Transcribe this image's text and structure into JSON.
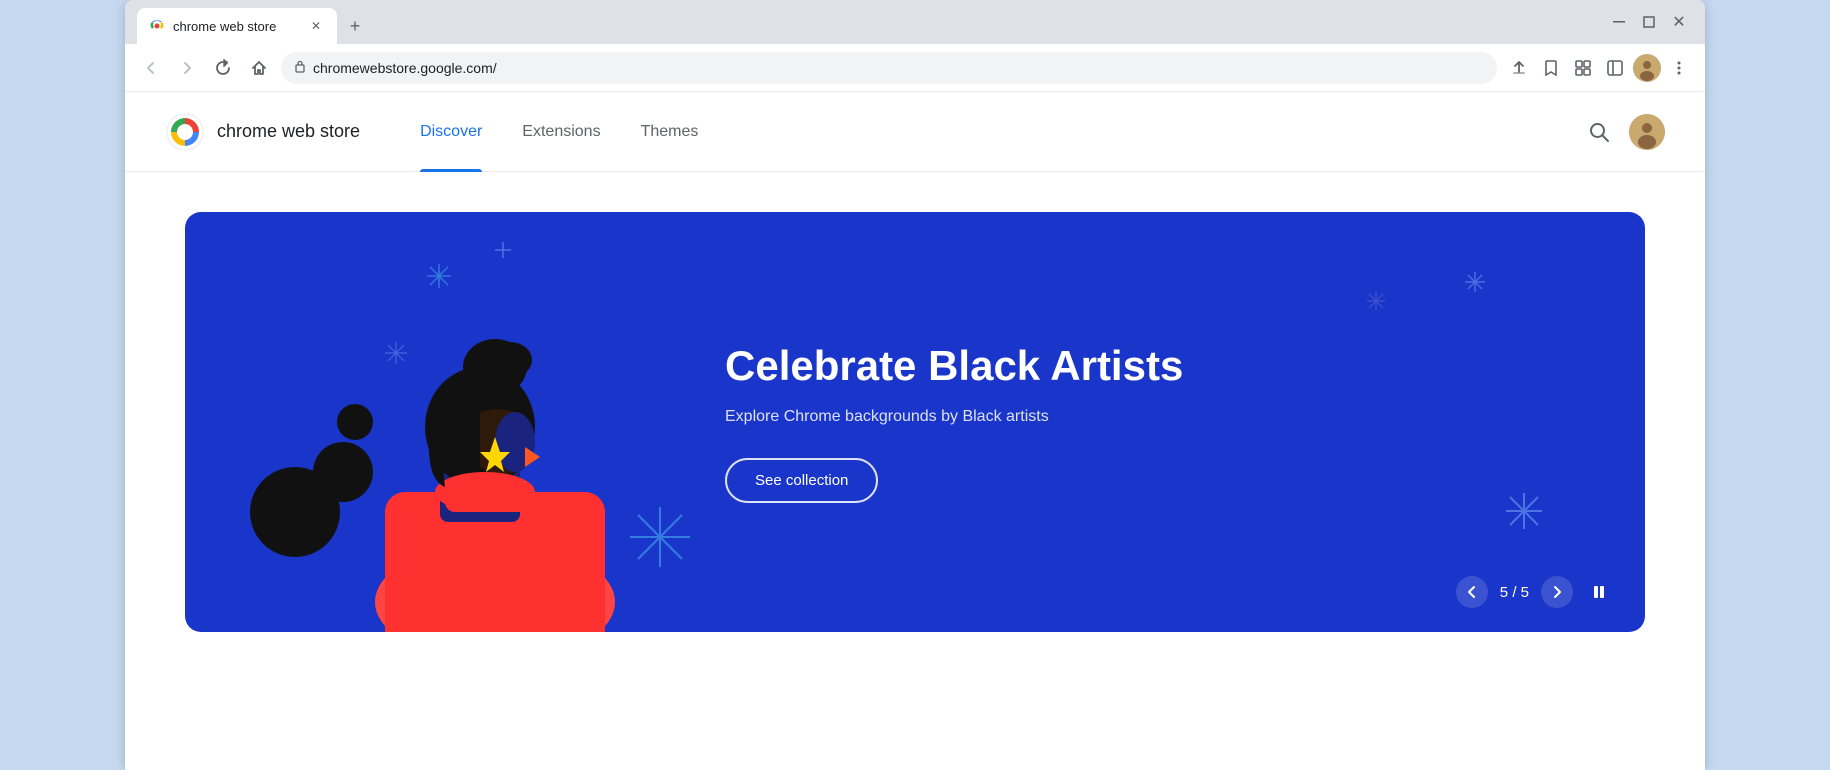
{
  "browser": {
    "tab_title": "chrome web store",
    "url": "chromewebstore.google.com/",
    "window_controls": {
      "minimize": "—",
      "maximize": "□",
      "close": "✕"
    },
    "nav": {
      "back_disabled": true,
      "forward_disabled": true
    }
  },
  "store": {
    "name": "chrome web store",
    "nav_items": [
      {
        "label": "Discover",
        "active": true
      },
      {
        "label": "Extensions",
        "active": false
      },
      {
        "label": "Themes",
        "active": false
      }
    ]
  },
  "hero": {
    "title": "Celebrate Black Artists",
    "subtitle": "Explore Chrome backgrounds by Black artists",
    "cta_label": "See collection",
    "carousel_current": "5",
    "carousel_total": "5"
  }
}
